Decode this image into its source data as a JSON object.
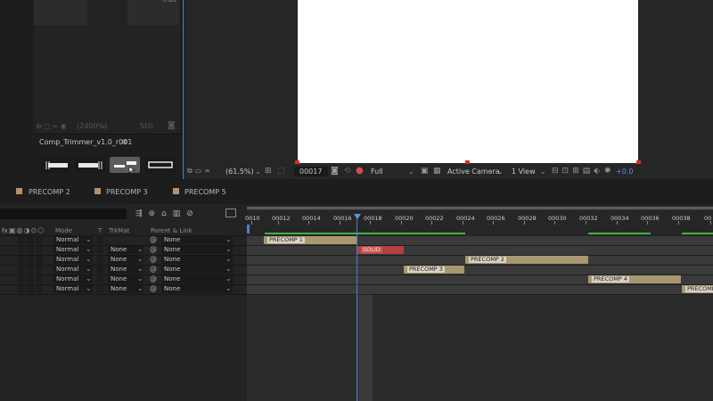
{
  "project_panel": {
    "partial_text": "rrun",
    "zoom": "(2400%)",
    "still_label": "Still",
    "comp_title": "Comp_Trimmer_v1.0_r001",
    "menu_glyph": "≡"
  },
  "viewer": {
    "magnification": "(61.5%)",
    "frame": "00017",
    "resolution": "Full",
    "camera": "Active Camera",
    "view_layout": "1 View",
    "exposure": "+0.0"
  },
  "tabs": [
    {
      "label": "PRECOMP 2"
    },
    {
      "label": "PRECOMP 3"
    },
    {
      "label": "PRECOMP 5"
    }
  ],
  "timeline_header": {
    "fx": "fx",
    "mode": "Mode",
    "t": "T",
    "trkmat": "TrkMat",
    "parent": "Parent & Link"
  },
  "ruler": [
    "0010",
    "00012",
    "00014",
    "00016",
    "00018",
    "00020",
    "00022",
    "00024",
    "00026",
    "00028",
    "00030",
    "00032",
    "00034",
    "00036",
    "00038",
    "00"
  ],
  "layers": [
    {
      "mode": "Normal",
      "trkmat": "",
      "parent": "None",
      "bar": "PRECOMP 1"
    },
    {
      "mode": "Normal",
      "trkmat": "None",
      "parent": "None",
      "bar": "SOLID"
    },
    {
      "mode": "Normal",
      "trkmat": "None",
      "parent": "None",
      "bar": "PRECOMP 2"
    },
    {
      "mode": "Normal",
      "trkmat": "None",
      "parent": "None",
      "bar": "PRECOMP 3"
    },
    {
      "mode": "Normal",
      "trkmat": "None",
      "parent": "None",
      "bar": "PRECOMP 4"
    },
    {
      "mode": "Normal",
      "trkmat": "None",
      "parent": "None",
      "bar": "PRECOMP"
    }
  ],
  "colors": {
    "precomp_bar": "#a8986f",
    "solid_bar": "#b3403f",
    "playhead": "#4a7fd8",
    "tab_swatch": "#b5906a",
    "work_area": "#3fb33f"
  }
}
